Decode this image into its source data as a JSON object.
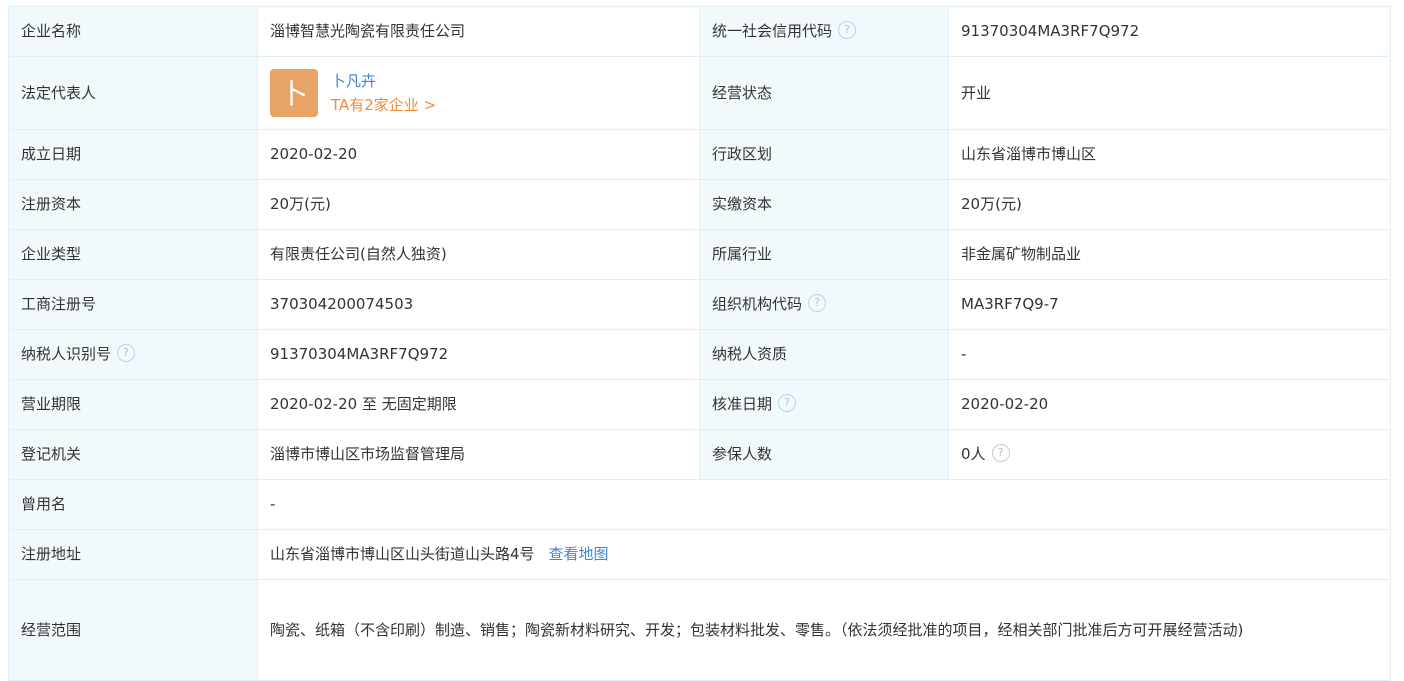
{
  "rows": {
    "company_name": {
      "label": "企业名称",
      "value": "淄博智慧光陶瓷有限责任公司"
    },
    "credit_code": {
      "label": "统一社会信用代码",
      "value": "91370304MA3RF7Q972"
    },
    "legal_rep": {
      "label": "法定代表人",
      "avatar_char": "卜",
      "name": "卜凡卉",
      "companies_link": "TA有2家企业 >"
    },
    "status": {
      "label": "经营状态",
      "value": "开业"
    },
    "established": {
      "label": "成立日期",
      "value": "2020-02-20"
    },
    "region": {
      "label": "行政区划",
      "value": "山东省淄博市博山区"
    },
    "registered_capital": {
      "label": "注册资本",
      "value": "20万(元)"
    },
    "paid_capital": {
      "label": "实缴资本",
      "value": "20万(元)"
    },
    "company_type": {
      "label": "企业类型",
      "value": "有限责任公司(自然人独资)"
    },
    "industry": {
      "label": "所属行业",
      "value": "非金属矿物制品业"
    },
    "reg_number": {
      "label": "工商注册号",
      "value": "370304200074503"
    },
    "org_code": {
      "label": "组织机构代码",
      "value": "MA3RF7Q9-7"
    },
    "taxpayer_id": {
      "label": "纳税人识别号",
      "value": "91370304MA3RF7Q972"
    },
    "taxpayer_qual": {
      "label": "纳税人资质",
      "value": "-"
    },
    "business_term": {
      "label": "营业期限",
      "value": "2020-02-20 至 无固定期限"
    },
    "approval_date": {
      "label": "核准日期",
      "value": "2020-02-20"
    },
    "authority": {
      "label": "登记机关",
      "value": "淄博市博山区市场监督管理局"
    },
    "insured": {
      "label": "参保人数",
      "value": "0人"
    },
    "former_name": {
      "label": "曾用名",
      "value": "-"
    },
    "address": {
      "label": "注册地址",
      "value": "山东省淄博市博山区山头街道山头路4号",
      "map_link": "查看地图"
    },
    "scope": {
      "label": "经营范围",
      "value": "陶瓷、纸箱（不含印刷）制造、销售；陶瓷新材料研究、开发；包装材料批发、零售。（依法须经批准的项目，经相关部门批准后方可开展经营活动)"
    }
  },
  "help_icon_glyph": "?",
  "colors": {
    "label_bg": "#f2f9fc",
    "border": "#e4eef6",
    "link": "#3c87d4",
    "accent": "#f08c3c",
    "avatar_bg": "#e8a467"
  }
}
